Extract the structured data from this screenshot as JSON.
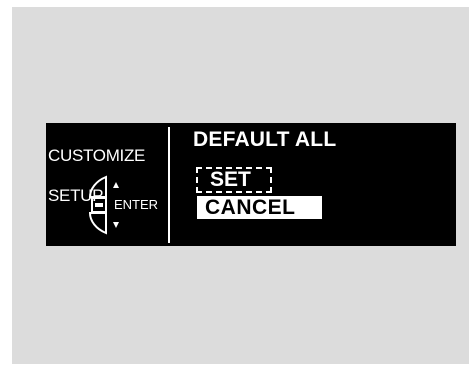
{
  "panel": {
    "title_line1": "CUSTOMIZE",
    "title_line2": "SETUP",
    "enter_label": "ENTER",
    "up_icon": "triangle-up-icon",
    "down_icon": "triangle-down-icon",
    "enter_icon": "enter-button-icon"
  },
  "screen": {
    "title": "DEFAULT ALL",
    "options": [
      {
        "label": "SET",
        "selected": false
      },
      {
        "label": "CANCEL",
        "selected": true
      }
    ]
  },
  "colors": {
    "background": "#dcdcdc",
    "display": "#000000",
    "text": "#ffffff"
  }
}
